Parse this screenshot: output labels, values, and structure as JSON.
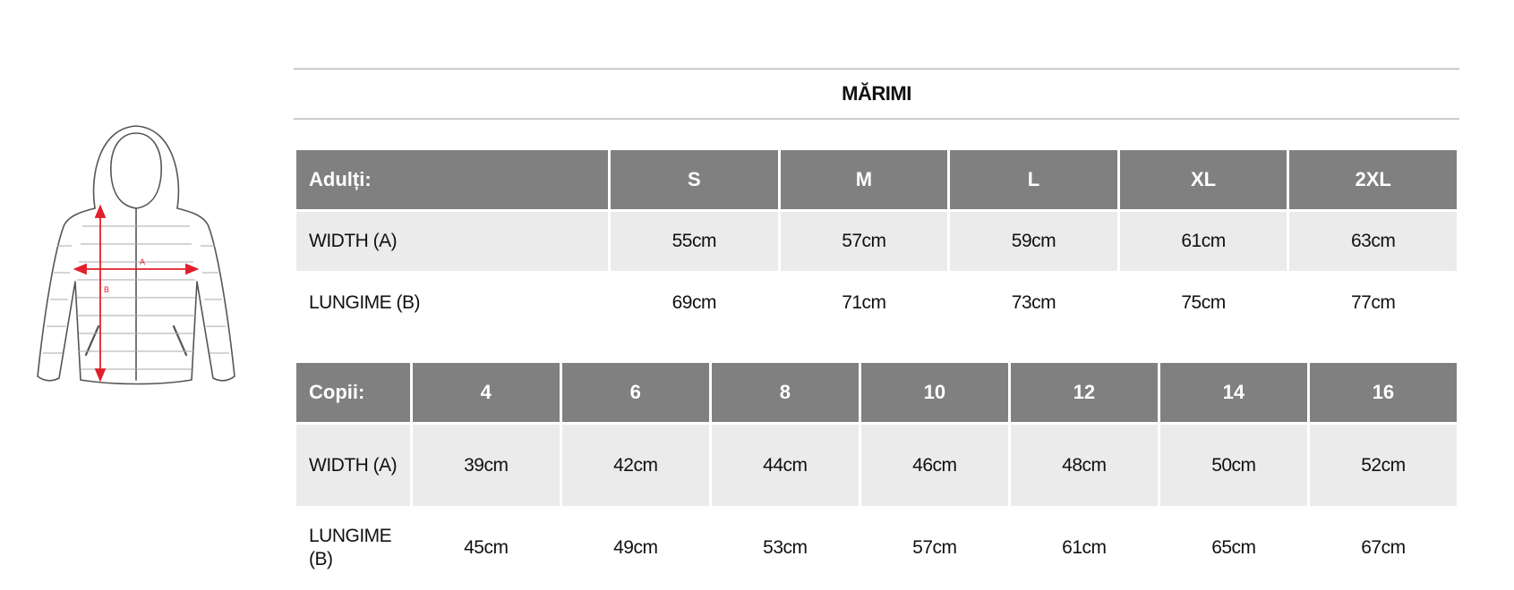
{
  "title": "MĂRIMI",
  "diagram": {
    "label_a": "A",
    "label_b": "B",
    "accent_color": "#e0202a"
  },
  "adults": {
    "header_label": "Adulți:",
    "sizes": [
      "S",
      "M",
      "L",
      "XL",
      "2XL"
    ],
    "rows": [
      {
        "label": "WIDTH (A)",
        "values": [
          "55cm",
          "57cm",
          "59cm",
          "61cm",
          "63cm"
        ]
      },
      {
        "label": "LUNGIME (B)",
        "values": [
          "69cm",
          "71cm",
          "73cm",
          "75cm",
          "77cm"
        ]
      }
    ]
  },
  "kids": {
    "header_label": "Copii:",
    "sizes": [
      "4",
      "6",
      "8",
      "10",
      "12",
      "14",
      "16"
    ],
    "rows": [
      {
        "label": "WIDTH (A)",
        "values": [
          "39cm",
          "42cm",
          "44cm",
          "46cm",
          "48cm",
          "50cm",
          "52cm"
        ]
      },
      {
        "label": "LUNGIME (B)",
        "values": [
          "45cm",
          "49cm",
          "53cm",
          "57cm",
          "61cm",
          "65cm",
          "67cm"
        ]
      }
    ]
  },
  "colors": {
    "header_bg": "#808080",
    "shaded_row_bg": "#ebebeb",
    "rule": "#cccccc"
  }
}
